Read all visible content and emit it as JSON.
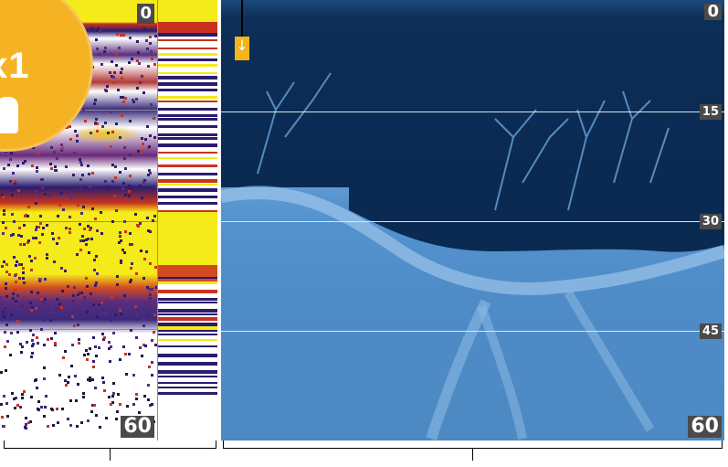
{
  "zoom_panel": {
    "badge_label": "x1",
    "top_depth": "0",
    "bottom_depth": "60"
  },
  "di_panel": {
    "depth_labels": [
      "0",
      "15",
      "30",
      "45",
      "60"
    ]
  },
  "colors": {
    "sonar_yellow": "#f5ea1a",
    "sonar_red": "#c8331e",
    "sonar_purple": "#2a1c6e",
    "di_water": "#0a2a52",
    "di_bottom": "#4a88c4",
    "badge": "#f5b324",
    "cursor": "#f2b51e"
  },
  "icons": {
    "cursor": "down-arrow-icon",
    "badge": "hand-icon"
  }
}
